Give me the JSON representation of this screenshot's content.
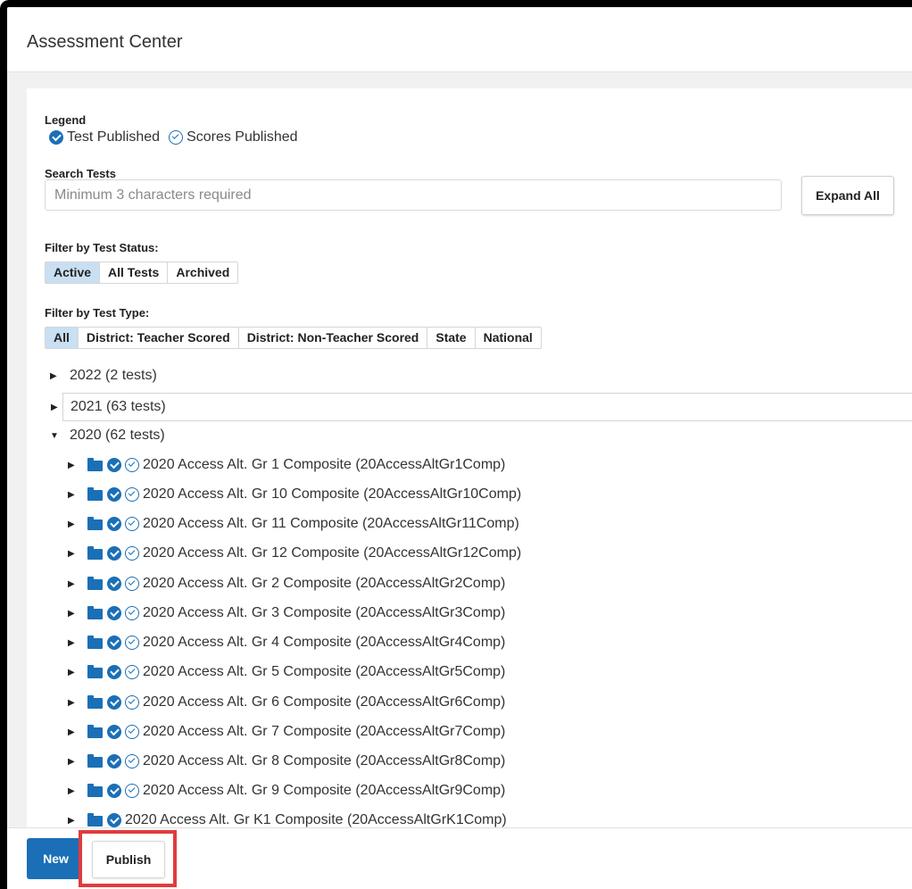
{
  "header": {
    "title": "Assessment Center"
  },
  "legend": {
    "heading": "Legend",
    "test_published": "Test Published",
    "scores_published": "Scores Published"
  },
  "search": {
    "heading": "Search Tests",
    "placeholder": "Minimum 3 characters required",
    "expand_all_label": "Expand All"
  },
  "filter_status": {
    "heading": "Filter by Test Status:",
    "options": [
      "Active",
      "All Tests",
      "Archived"
    ],
    "selected": "Active"
  },
  "filter_type": {
    "heading": "Filter by Test Type:",
    "options": [
      "All",
      "District: Teacher Scored",
      "District: Non-Teacher Scored",
      "State",
      "National"
    ],
    "selected": "All"
  },
  "tree": {
    "years": [
      {
        "label": "2022 (2 tests)",
        "expanded": false
      },
      {
        "label": "2021 (63 tests)",
        "expanded": false
      },
      {
        "label": "2020 (62 tests)",
        "expanded": true
      }
    ],
    "tests_2020": [
      {
        "label": "2020 Access Alt. Gr 1 Composite (20AccessAltGr1Comp)",
        "test_published": true,
        "scores_published": true
      },
      {
        "label": "2020 Access Alt. Gr 10 Composite (20AccessAltGr10Comp)",
        "test_published": true,
        "scores_published": true
      },
      {
        "label": "2020 Access Alt. Gr 11 Composite (20AccessAltGr11Comp)",
        "test_published": true,
        "scores_published": true
      },
      {
        "label": "2020 Access Alt. Gr 12 Composite (20AccessAltGr12Comp)",
        "test_published": true,
        "scores_published": true
      },
      {
        "label": "2020 Access Alt. Gr 2 Composite (20AccessAltGr2Comp)",
        "test_published": true,
        "scores_published": true
      },
      {
        "label": "2020 Access Alt. Gr 3 Composite (20AccessAltGr3Comp)",
        "test_published": true,
        "scores_published": true
      },
      {
        "label": "2020 Access Alt. Gr 4 Composite (20AccessAltGr4Comp)",
        "test_published": true,
        "scores_published": true
      },
      {
        "label": "2020 Access Alt. Gr 5 Composite (20AccessAltGr5Comp)",
        "test_published": true,
        "scores_published": true
      },
      {
        "label": "2020 Access Alt. Gr 6 Composite (20AccessAltGr6Comp)",
        "test_published": true,
        "scores_published": true
      },
      {
        "label": "2020 Access Alt. Gr 7 Composite (20AccessAltGr7Comp)",
        "test_published": true,
        "scores_published": true
      },
      {
        "label": "2020 Access Alt. Gr 8 Composite (20AccessAltGr8Comp)",
        "test_published": true,
        "scores_published": true
      },
      {
        "label": "2020 Access Alt. Gr 9 Composite (20AccessAltGr9Comp)",
        "test_published": true,
        "scores_published": true
      },
      {
        "label": "2020 Access Alt. Gr K1 Composite (20AccessAltGrK1Comp)",
        "test_published": true,
        "scores_published": false
      }
    ]
  },
  "footer": {
    "new_label": "New",
    "publish_label": "Publish"
  },
  "colors": {
    "accent": "#1b6fb7",
    "selected_segment": "#c9dff2",
    "highlight_box": "#e03c3c",
    "top_accent": "#7ab800"
  },
  "icons": {
    "collapsed_caret": "caret-right-icon",
    "expanded_caret": "caret-down-icon",
    "folder": "folder-icon",
    "test_published": "check-circle-solid-icon",
    "scores_published": "check-circle-outline-icon"
  }
}
